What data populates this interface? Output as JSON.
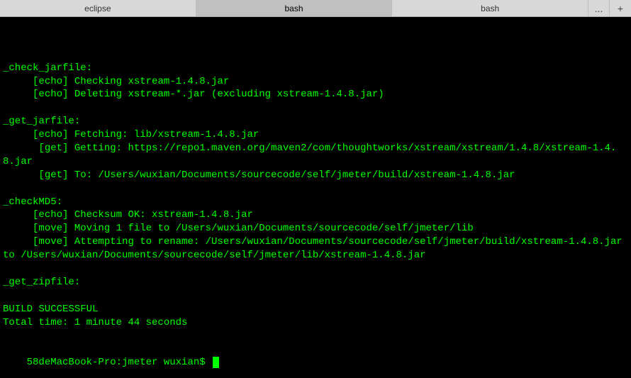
{
  "tabs": {
    "items": [
      {
        "label": "eclipse",
        "active": false
      },
      {
        "label": "bash",
        "active": true
      },
      {
        "label": "bash",
        "active": false
      }
    ],
    "more": "...",
    "add": "+"
  },
  "terminal": {
    "lines": "\n_check_jarfile:\n     [echo] Checking xstream-1.4.8.jar\n     [echo] Deleting xstream-*.jar (excluding xstream-1.4.8.jar)\n\n_get_jarfile:\n     [echo] Fetching: lib/xstream-1.4.8.jar\n      [get] Getting: https://repo1.maven.org/maven2/com/thoughtworks/xstream/xstream/1.4.8/xstream-1.4.8.jar\n      [get] To: /Users/wuxian/Documents/sourcecode/self/jmeter/build/xstream-1.4.8.jar\n\n_checkMD5:\n     [echo] Checksum OK: xstream-1.4.8.jar\n     [move] Moving 1 file to /Users/wuxian/Documents/sourcecode/self/jmeter/lib\n     [move] Attempting to rename: /Users/wuxian/Documents/sourcecode/self/jmeter/build/xstream-1.4.8.jar to /Users/wuxian/Documents/sourcecode/self/jmeter/lib/xstream-1.4.8.jar\n\n_get_zipfile:\n\nBUILD SUCCESSFUL\nTotal time: 1 minute 44 seconds",
    "prompt": "58deMacBook-Pro:jmeter wuxian$ "
  }
}
